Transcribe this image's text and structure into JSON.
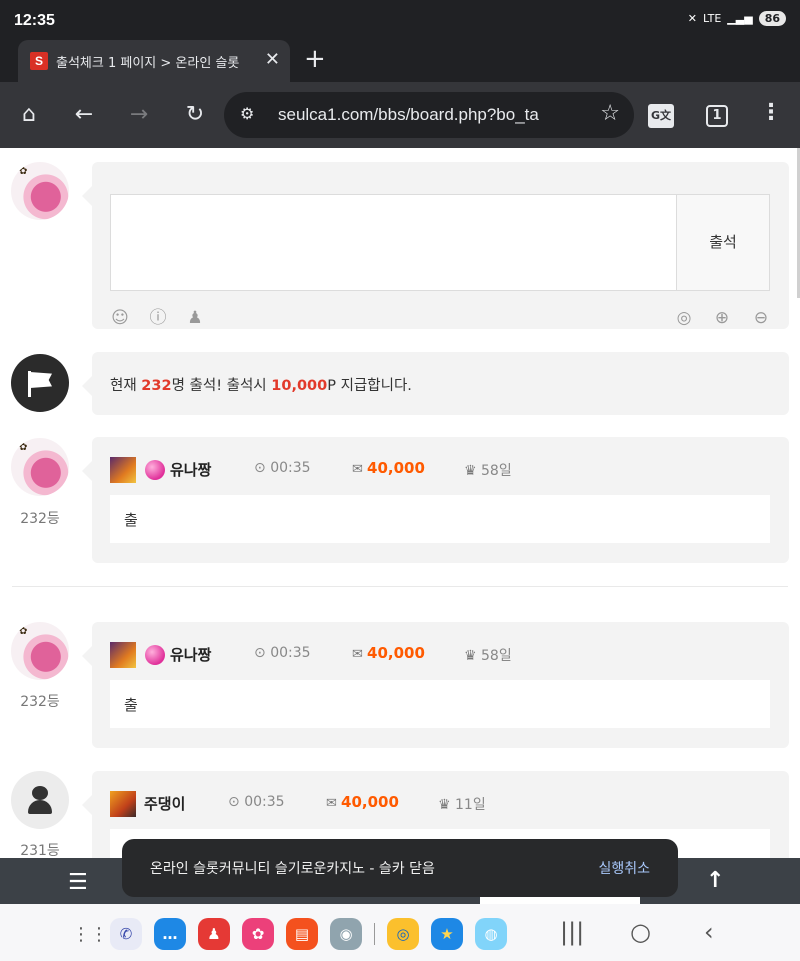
{
  "status": {
    "time": "12:35",
    "network": "LTE",
    "battery": "86"
  },
  "tab": {
    "favicon": "S",
    "title": "출석체크 1 페이지 > 온라인 슬롯",
    "close": "✕",
    "new_tab": "+"
  },
  "toolbar": {
    "url": "seulca1.com/bbs/board.php?bo_ta",
    "tabs_count": "1",
    "icons": [
      "home-icon",
      "back-icon",
      "forward-icon",
      "reload-icon",
      "tune-icon",
      "star-icon",
      "translate-icon",
      "tabs-icon",
      "menu-icon"
    ]
  },
  "compose": {
    "submit_label": "출석",
    "icons": [
      "smile-icon",
      "info-icon",
      "user-icon",
      "emoticon-icon",
      "plus-icon",
      "minus-icon"
    ]
  },
  "notice": {
    "prefix": "현재 ",
    "count": "232",
    "middle": "명 출석! 출석시 ",
    "points": "10,000",
    "suffix": "P 지급합니다."
  },
  "entries": [
    {
      "rank": "232등",
      "nickname": "유나짱",
      "time": "00:35",
      "points": "40,000",
      "days": "58일",
      "message": "출"
    },
    {
      "rank": "232등",
      "nickname": "유나짱",
      "time": "00:35",
      "points": "40,000",
      "days": "58일",
      "message": "출"
    },
    {
      "rank": "231등",
      "nickname": "주댕이",
      "time": "00:35",
      "points": "40,000",
      "days": "11일",
      "message": ""
    }
  ],
  "snackbar": {
    "text": "온라인 슬롯커뮤니티 슬기로운카지노 - 슬카 닫음",
    "action": "실행취소"
  },
  "colors": {
    "accent_red": "#e23a2b",
    "points_orange": "#ff5a00",
    "chrome_dark": "#202124",
    "chrome_toolbar": "#35363a"
  }
}
